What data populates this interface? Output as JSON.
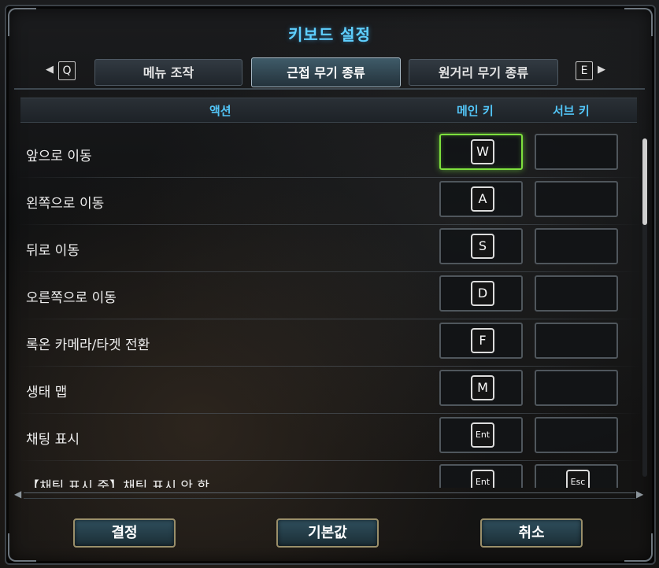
{
  "window": {
    "title": "키보드 설정"
  },
  "tabs": {
    "prev_key": "Q",
    "next_key": "E",
    "items": [
      {
        "label": "메뉴 조작"
      },
      {
        "label": "근접 무기 종류"
      },
      {
        "label": "원거리 무기 종류"
      }
    ],
    "active_index": 1
  },
  "table": {
    "headers": {
      "action": "액션",
      "main": "메인 키",
      "sub": "서브 키"
    },
    "rows": [
      {
        "action": "앞으로 이동",
        "main": "W",
        "sub": ""
      },
      {
        "action": "왼쪽으로 이동",
        "main": "A",
        "sub": ""
      },
      {
        "action": "뒤로 이동",
        "main": "S",
        "sub": ""
      },
      {
        "action": "오른쪽으로 이동",
        "main": "D",
        "sub": ""
      },
      {
        "action": "록온 카메라/타겟 전환",
        "main": "F",
        "sub": ""
      },
      {
        "action": "생태 맵",
        "main": "M",
        "sub": ""
      },
      {
        "action": "채팅 표시",
        "main": "Ent",
        "sub": ""
      },
      {
        "action": "【채팅 표시 중】채팅 표시 안 함",
        "main": "Ent",
        "sub": "Esc"
      }
    ],
    "selected_row": 0
  },
  "buttons": {
    "confirm": "결정",
    "default": "기본값",
    "cancel": "취소"
  },
  "colors": {
    "accent": "#5fd0ff",
    "selection": "#7ee03d",
    "button_border": "#9a8f6a"
  }
}
